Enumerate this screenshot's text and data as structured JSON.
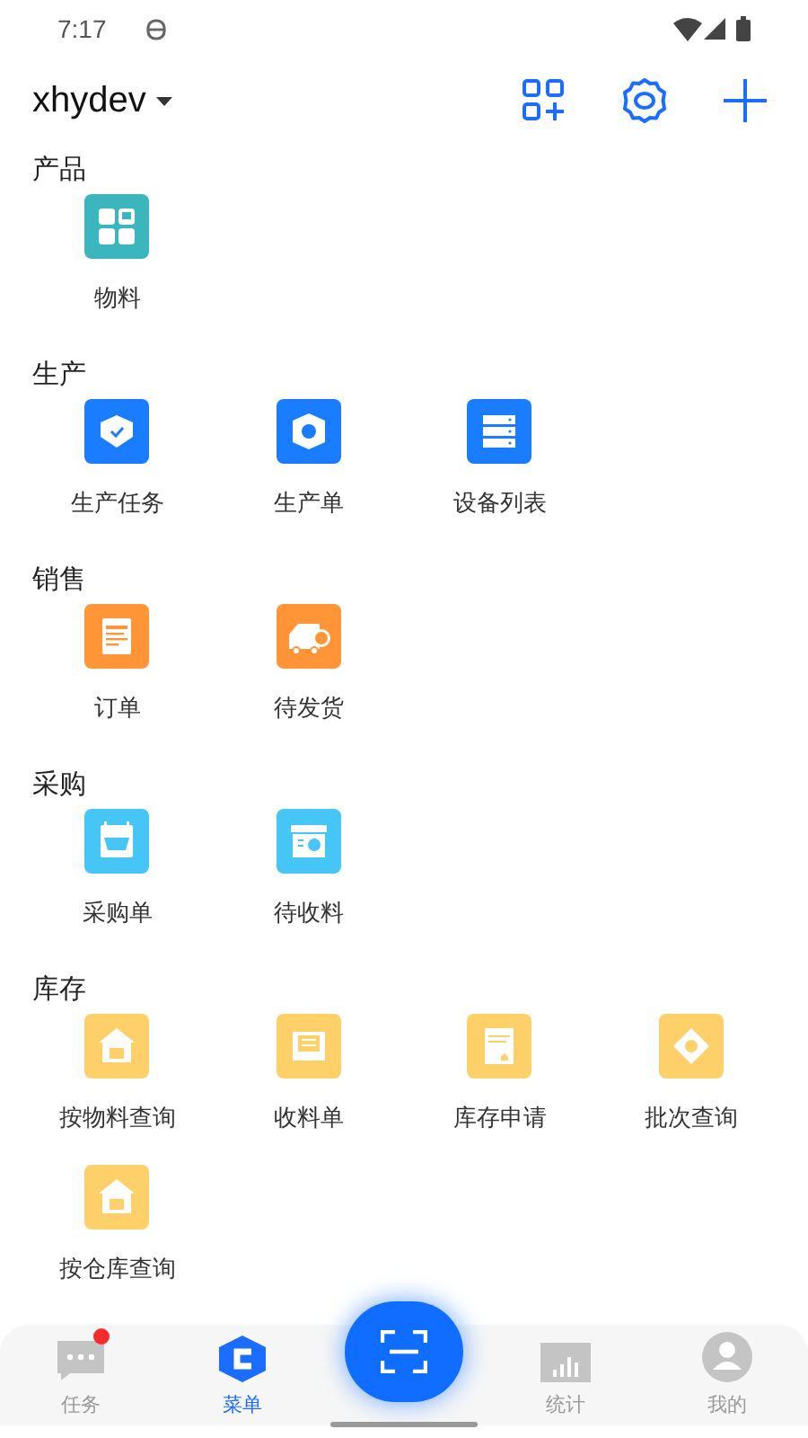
{
  "status_bar": {
    "time": "7:17"
  },
  "header": {
    "account": "xhydev"
  },
  "sections": [
    {
      "title": "产品",
      "color": "#3bb6bf",
      "items": [
        {
          "label": "物料",
          "kind": "grid"
        }
      ]
    },
    {
      "title": "生产",
      "color": "#1a7dff",
      "items": [
        {
          "label": "生产任务",
          "kind": "badge"
        },
        {
          "label": "生产单",
          "kind": "nut"
        },
        {
          "label": "设备列表",
          "kind": "server"
        }
      ]
    },
    {
      "title": "销售",
      "color": "#ff9536",
      "items": [
        {
          "label": "订单",
          "kind": "clipboard"
        },
        {
          "label": "待发货",
          "kind": "truck"
        }
      ]
    },
    {
      "title": "采购",
      "color": "#45c6f7",
      "items": [
        {
          "label": "采购单",
          "kind": "basket"
        },
        {
          "label": "待收料",
          "kind": "box"
        }
      ]
    },
    {
      "title": "库存",
      "color": "#fdd06a",
      "items": [
        {
          "label": "按物料查询",
          "kind": "house"
        },
        {
          "label": "收料单",
          "kind": "tray"
        },
        {
          "label": "库存申请",
          "kind": "document"
        },
        {
          "label": "批次查询",
          "kind": "target"
        },
        {
          "label": "按仓库查询",
          "kind": "house"
        }
      ]
    }
  ],
  "tab_bar": [
    {
      "label": "任务",
      "kind": "chat",
      "selected": false,
      "unread": true
    },
    {
      "label": "菜单",
      "kind": "logo",
      "selected": true,
      "unread": false
    },
    {
      "kind": "scan"
    },
    {
      "label": "统计",
      "kind": "chart",
      "selected": false,
      "unread": false
    },
    {
      "label": "我的",
      "kind": "person",
      "selected": false,
      "unread": false
    }
  ]
}
